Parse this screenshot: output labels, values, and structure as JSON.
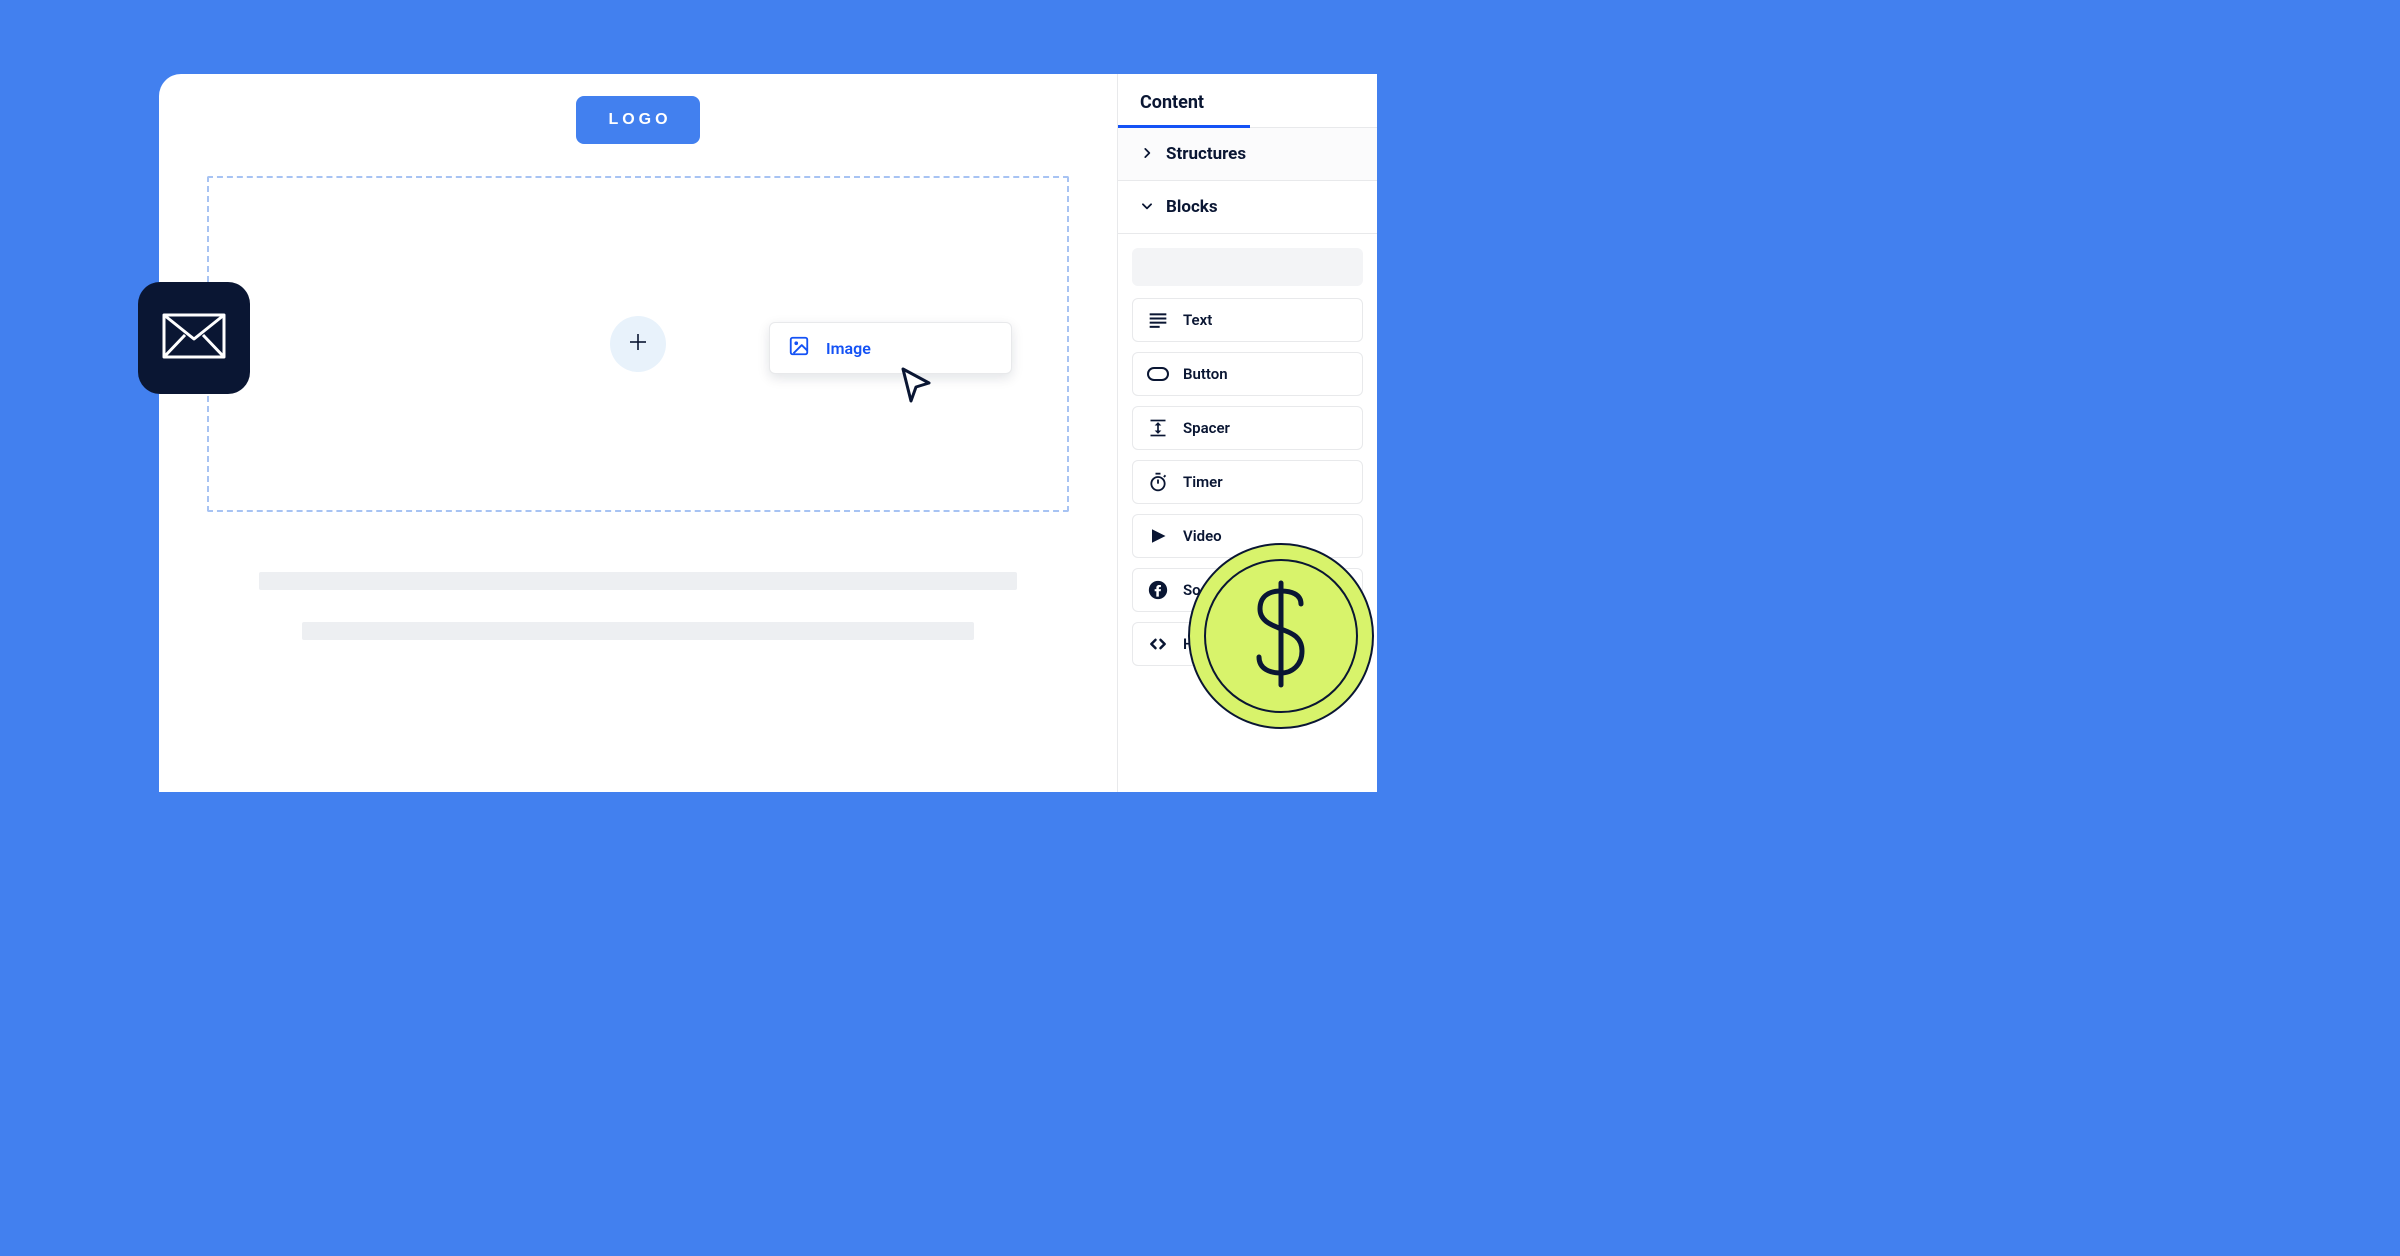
{
  "canvas": {
    "logo_label": "LOGO"
  },
  "dragged": {
    "label": "Image"
  },
  "sidebar": {
    "tab_label": "Content",
    "sections": {
      "structures": "Structures",
      "blocks": "Blocks"
    },
    "blocks": [
      {
        "name": "text",
        "label": "Text"
      },
      {
        "name": "button",
        "label": "Button"
      },
      {
        "name": "spacer",
        "label": "Spacer"
      },
      {
        "name": "timer",
        "label": "Timer"
      },
      {
        "name": "video",
        "label": "Video"
      },
      {
        "name": "social",
        "label": "Social"
      },
      {
        "name": "html",
        "label": "HTML"
      }
    ]
  },
  "colors": {
    "bg": "#4280EF",
    "accent": "#1452F5",
    "dark": "#0A1633",
    "lime": "#D8F36B"
  }
}
